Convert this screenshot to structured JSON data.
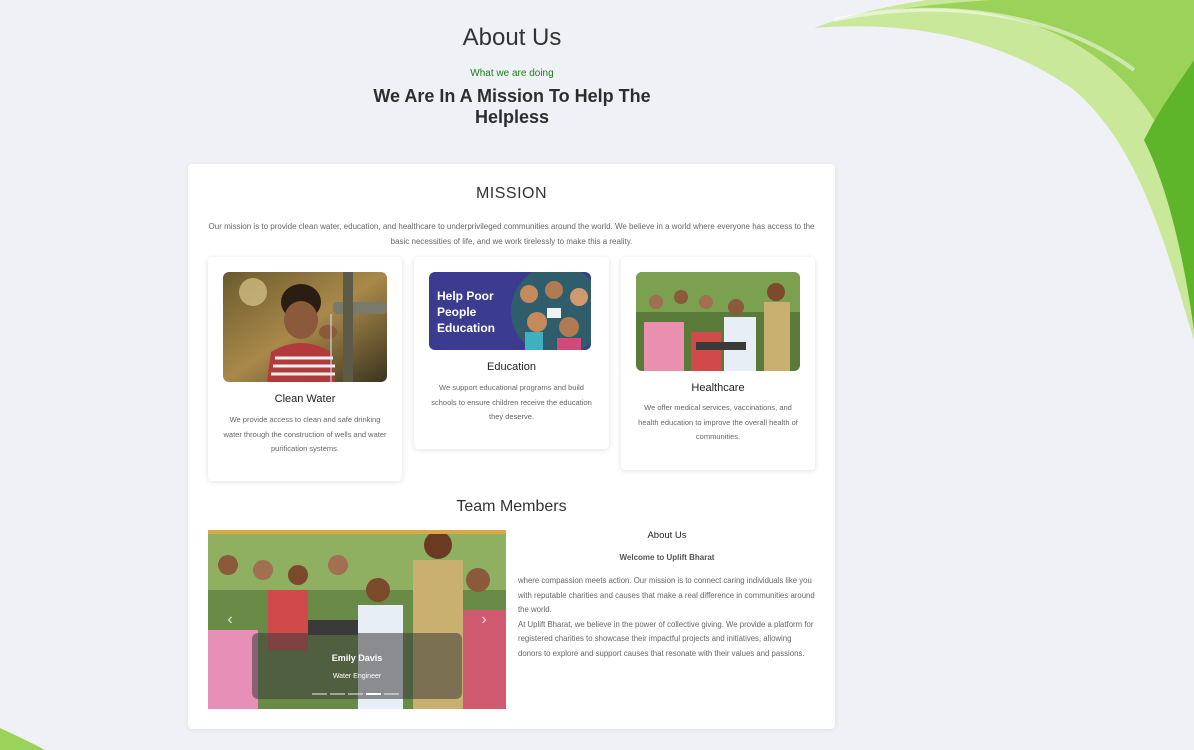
{
  "hero": {
    "title": "About Us",
    "kicker": "What we are doing",
    "heading": "We Are In A Mission To Help The Helpless"
  },
  "mission": {
    "title": "MISSION",
    "text": "Our mission is to provide clean water, education, and healthcare to underprivileged communities around the world. We believe in a world where everyone has access to the basic necessities of life, and we work tirelessly to make this a reality."
  },
  "features": [
    {
      "title": "Clean Water",
      "desc": "We provide access to clean and safe drinking water through the construction of wells and water purification systems."
    },
    {
      "title": "Education",
      "desc": "We support educational programs and build schools to ensure children receive the education they deserve.",
      "banner": "Help Poor People Education"
    },
    {
      "title": "Healthcare",
      "desc": "We offer medical services, vaccinations, and health education to improve the overall health of communities."
    }
  ],
  "team": {
    "title": "Team Members",
    "carousel": {
      "name": "Emily Davis",
      "role": "Water Engineer",
      "slide_count": 5,
      "active_index": 3
    }
  },
  "about": {
    "title": "About Us",
    "subtitle": "Welcome to Uplift Bharat",
    "p1": "where compassion meets action. Our mission is to connect caring individuals like you with reputable charities and causes that make a real difference in communities around the world.",
    "p2": "At Uplift Bharat, we believe in the power of collective giving. We provide a platform for registered charities to showcase their impactful projects and initiatives, allowing donors to explore and support causes that resonate with their values and passions."
  },
  "colors": {
    "accent_green": "#1a7d1a",
    "leaf_light": "#c9e89a",
    "leaf_dark": "#5fb52a",
    "education_banner": "#3b3b8f"
  },
  "icons": [
    "chevron-left-icon",
    "chevron-right-icon"
  ]
}
